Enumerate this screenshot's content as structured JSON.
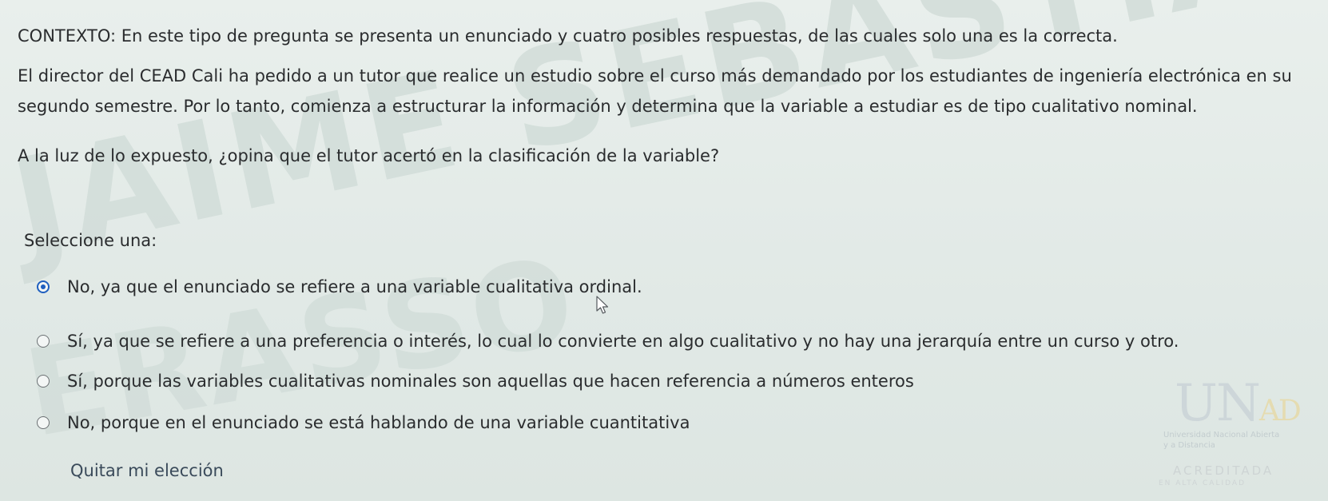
{
  "context_text": "CONTEXTO: En este tipo de pregunta se presenta un enunciado y cuatro posibles respuestas, de las cuales solo una es la correcta.",
  "statement_text": "El director del CEAD Cali ha pedido a un tutor que realice un estudio sobre el curso más demandado por los estudiantes de ingeniería electrónica en su segundo semestre. Por lo tanto, comienza a estructurar la información y determina que la variable a estudiar es de tipo cualitativo nominal.",
  "question_text": "A la luz de lo expuesto, ¿opina que el tutor acertó en la clasificación de la variable?",
  "prompt_label": "Seleccione una:",
  "options": [
    {
      "label": "No, ya que el enunciado se refiere a una variable cualitativa ordinal.",
      "selected": true
    },
    {
      "label": "Sí, ya que se refiere a una preferencia o interés, lo cual lo convierte en algo cualitativo y no hay una jerarquía entre un curso y otro.",
      "selected": false
    },
    {
      "label": "Sí, porque las variables cualitativas nominales son aquellas que hacen referencia a números enteros",
      "selected": false
    },
    {
      "label": "No, porque en el enunciado se está hablando de una variable cuantitativa",
      "selected": false
    }
  ],
  "clear_choice_label": "Quitar mi elección",
  "watermark": {
    "line1": "JAIME SEBASTIAN CASTILLO",
    "line2": "ERASSO"
  },
  "logo": {
    "mark": "UN",
    "mark_accent": "AD",
    "subtitle": "Universidad Nacional Abierta y a Distancia",
    "acreditada": "ACREDITADA",
    "acreditada_sub": "EN ALTA CALIDAD"
  },
  "colors": {
    "background": "#e4ebe8",
    "text": "#2a2c2e",
    "radio_selected": "#1f5fbf"
  }
}
